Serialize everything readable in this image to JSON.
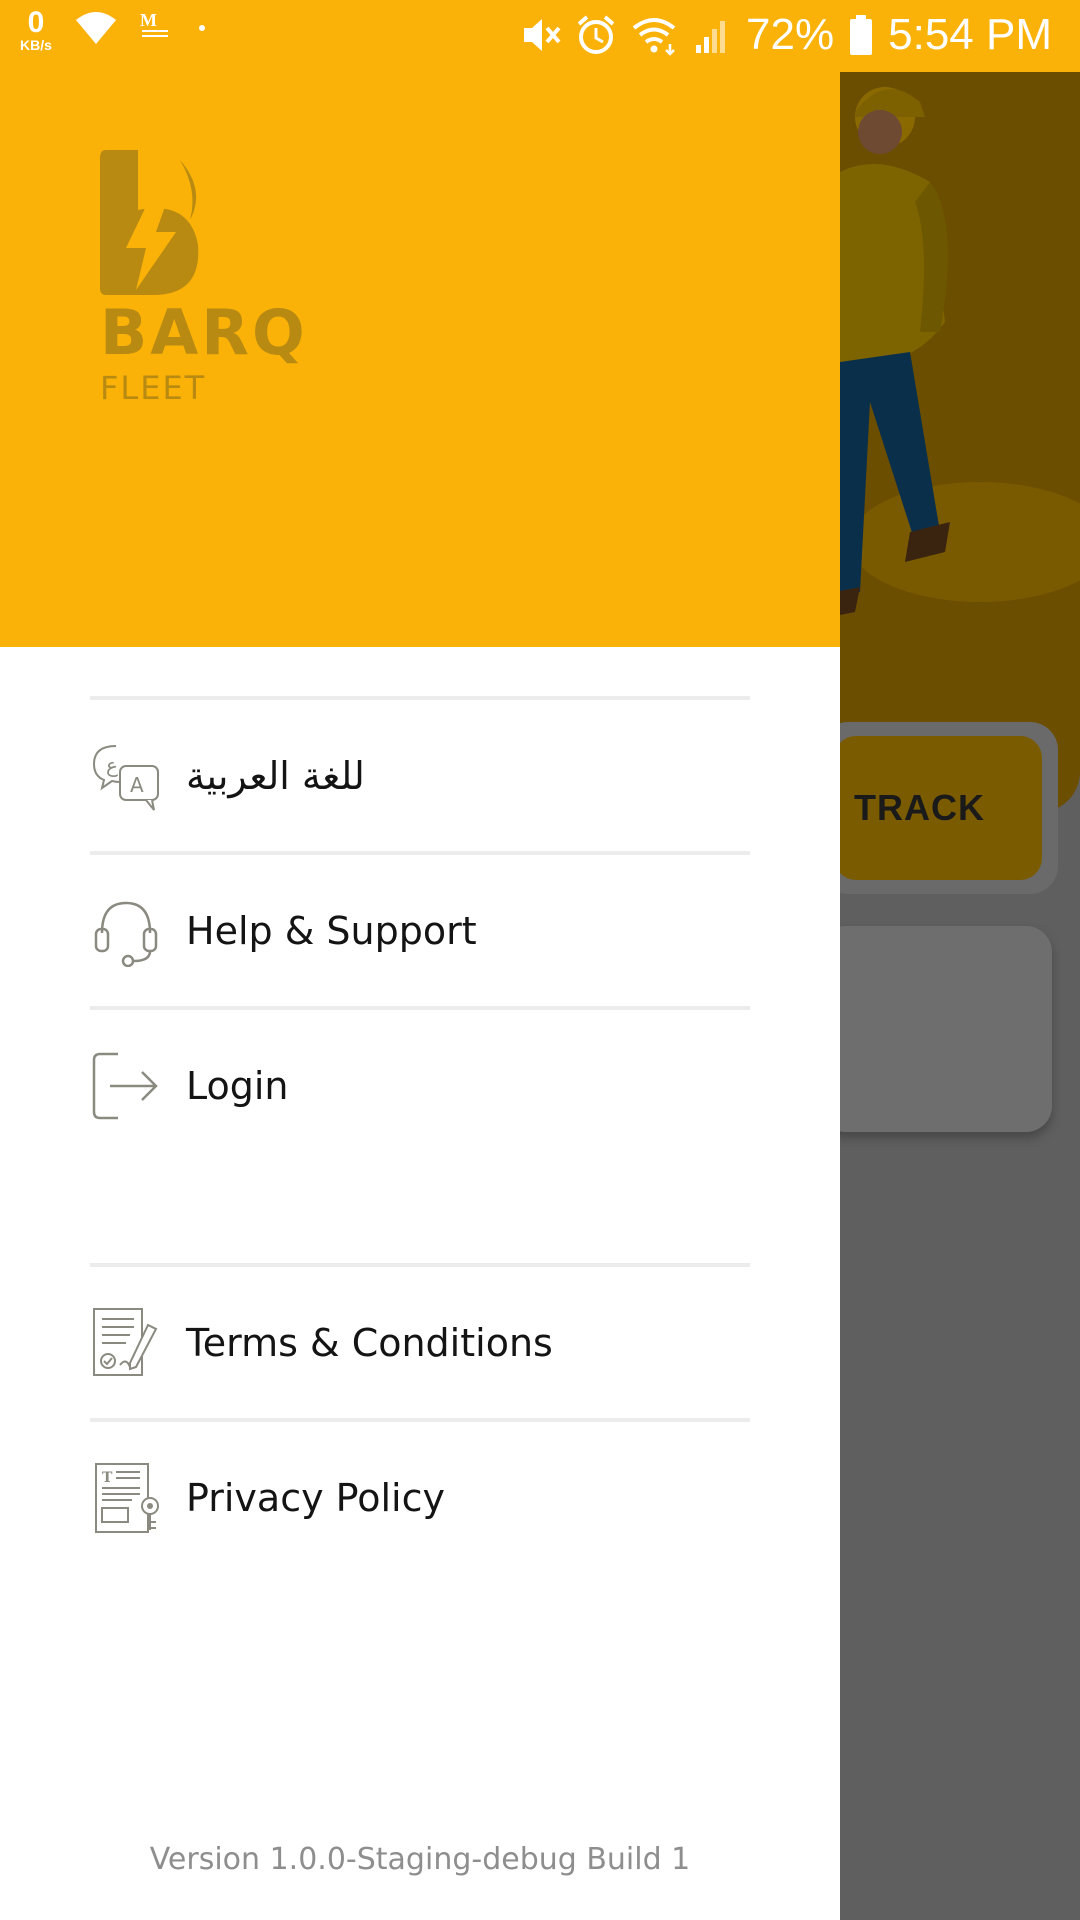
{
  "status_bar": {
    "data_speed_value": "0",
    "data_speed_unit": "KB/s",
    "battery_percent": "72%",
    "time": "5:54 PM",
    "icons": [
      "wifi-icon",
      "gmail-icon",
      "dot-icon",
      "mute-icon",
      "alarm-icon",
      "wifi-calling-icon",
      "signal-icon",
      "battery-icon"
    ]
  },
  "brand": {
    "name": "BARQ",
    "sub": "FLEET",
    "header_color": "#fab208",
    "logo_color": "#b98a11"
  },
  "menu": {
    "items": [
      {
        "label": "للغة العربية",
        "icon": "language-translate-icon"
      },
      {
        "label": "Help & Support",
        "icon": "headset-icon"
      },
      {
        "label": "Login",
        "icon": "login-arrow-icon"
      },
      {
        "label": "Terms & Conditions",
        "icon": "terms-document-icon"
      },
      {
        "label": "Privacy Policy",
        "icon": "privacy-document-icon"
      }
    ]
  },
  "footer": {
    "version": "Version 1.0.0-Staging-debug Build 1"
  },
  "background_screen": {
    "track_label": "TRACK"
  }
}
